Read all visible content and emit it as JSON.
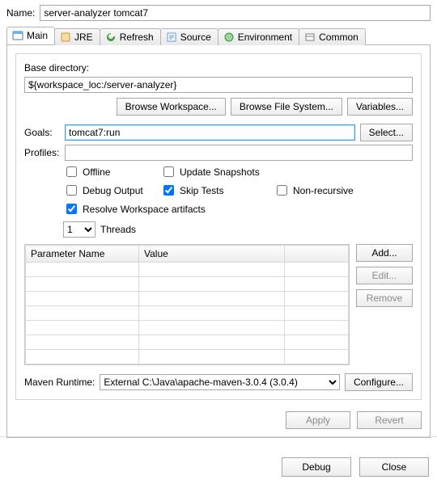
{
  "name_label": "Name:",
  "name_value": "server-analyzer tomcat7",
  "tabs": [
    {
      "label": "Main"
    },
    {
      "label": "JRE"
    },
    {
      "label": "Refresh"
    },
    {
      "label": "Source"
    },
    {
      "label": "Environment"
    },
    {
      "label": "Common"
    }
  ],
  "base_dir_label": "Base directory:",
  "base_dir_value": "${workspace_loc:/server-analyzer}",
  "buttons": {
    "browse_workspace": "Browse Workspace...",
    "browse_fs": "Browse File System...",
    "variables": "Variables...",
    "select": "Select...",
    "add": "Add...",
    "edit": "Edit...",
    "remove": "Remove",
    "configure": "Configure...",
    "apply": "Apply",
    "revert": "Revert",
    "debug": "Debug",
    "close": "Close"
  },
  "goals_label": "Goals:",
  "goals_value": "tomcat7:run",
  "profiles_label": "Profiles:",
  "profiles_value": "",
  "checkboxes": {
    "offline": {
      "label": "Offline",
      "checked": false
    },
    "update_snapshots": {
      "label": "Update Snapshots",
      "checked": false
    },
    "debug_output": {
      "label": "Debug Output",
      "checked": false
    },
    "skip_tests": {
      "label": "Skip Tests",
      "checked": true
    },
    "non_recursive": {
      "label": "Non-recursive",
      "checked": false
    },
    "resolve_workspace": {
      "label": "Resolve Workspace artifacts",
      "checked": true
    }
  },
  "threads": {
    "value": "1",
    "label": "Threads"
  },
  "table": {
    "col_param": "Parameter Name",
    "col_value": "Value"
  },
  "runtime_label": "Maven Runtime:",
  "runtime_value": "External C:\\Java\\apache-maven-3.0.4 (3.0.4)"
}
